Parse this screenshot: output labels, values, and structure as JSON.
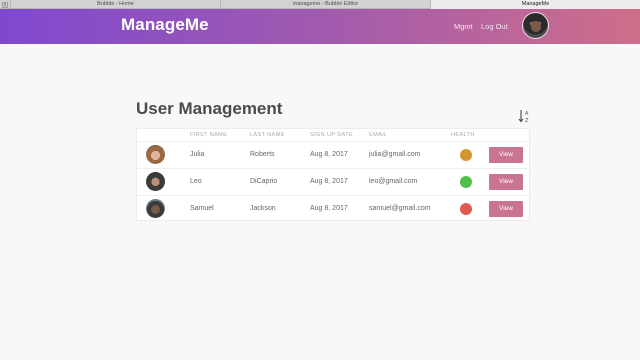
{
  "browser": {
    "tabs": [
      {
        "title": "Bubble - Home"
      },
      {
        "title": "manageme - Bubble Editor"
      },
      {
        "title": "ManageMe"
      }
    ],
    "close_glyph": "x"
  },
  "navbar": {
    "brand": "ManageMe",
    "links": {
      "mgmt": "Mgmt",
      "logout": "Log Out"
    },
    "gradient": [
      "#7f48cf",
      "#cf6e8a"
    ]
  },
  "main": {
    "title": "User Management",
    "sort_icon": "sort-alpha-icon"
  },
  "table": {
    "columns": [
      "FIRST NAME",
      "LAST NAME",
      "SIGN UP DATE",
      "EMAIL",
      "HEALTH"
    ],
    "rows": [
      {
        "first_name": "Julia",
        "last_name": "Roberts",
        "signup_date": "Aug 8, 2017",
        "email": "julia@gmail.com",
        "health_color": "#d4972e",
        "action": "View"
      },
      {
        "first_name": "Leo",
        "last_name": "DiCaprio",
        "signup_date": "Aug 8, 2017",
        "email": "leo@gmail.com",
        "health_color": "#4fbf4a",
        "action": "View"
      },
      {
        "first_name": "Samuel",
        "last_name": "Jackson",
        "signup_date": "Aug 8, 2017",
        "email": "samuel@gmail.com",
        "health_color": "#e25a4e",
        "action": "View"
      }
    ]
  },
  "colors": {
    "view_button": "#c97592",
    "title_text": "#4b4b4b"
  }
}
